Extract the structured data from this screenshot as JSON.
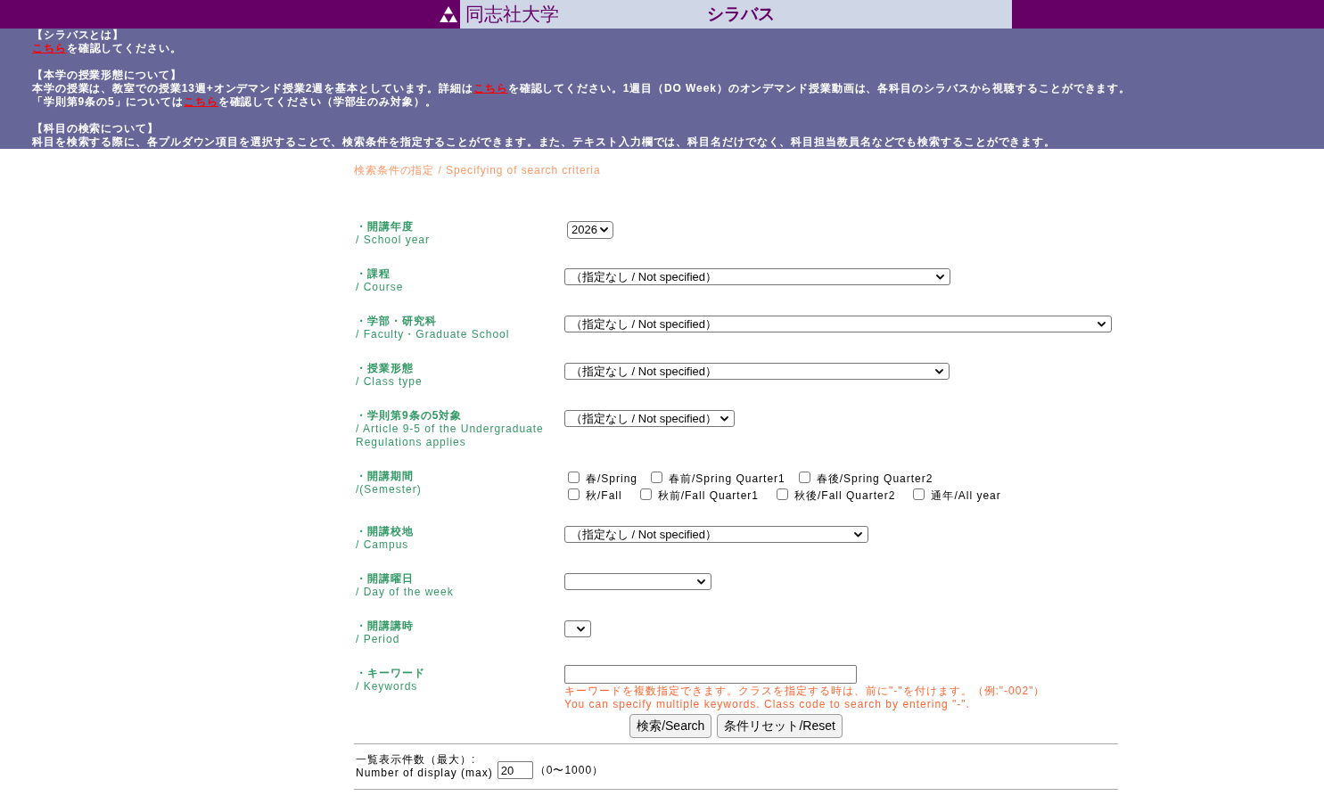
{
  "header": {
    "university": "同志社大学",
    "title": "シラバス"
  },
  "notices": [
    {
      "heading": "【シラバスとは】",
      "lines": [
        [
          {
            "kind": "link",
            "text": "こちら"
          },
          {
            "kind": "text",
            "text": "を確認してください。"
          }
        ]
      ]
    },
    {
      "heading": "【本学の授業形態について】",
      "lines": [
        [
          {
            "kind": "text",
            "text": "本学の授業は、教室での授業13週+オンデマンド授業2週を基本としています。詳細は"
          },
          {
            "kind": "link",
            "text": "こちら"
          },
          {
            "kind": "text",
            "text": "を確認してください。1週目（DO Week）のオンデマンド授業動画は、各科目のシラバスから視聴することができます。"
          }
        ],
        [
          {
            "kind": "text",
            "text": "「学則第9条の5」については"
          },
          {
            "kind": "link",
            "text": "こちら"
          },
          {
            "kind": "text",
            "text": "を確認してください（学部生のみ対象）。"
          }
        ]
      ]
    },
    {
      "heading": "【科目の検索について】",
      "lines": [
        [
          {
            "kind": "text",
            "text": "科目を検索する際に、各プルダウン項目を選択することで、検索条件を指定することができます。また、テキスト入力欄では、科目名だけでなく、科目担当教員名などでも検索することができます。"
          }
        ]
      ]
    }
  ],
  "search_form": {
    "title": "検索条件の指定 / Specifying of search criteria",
    "fields": [
      {
        "kind": "select",
        "label_ja": "・開講年度",
        "label_en": "/ School year",
        "value": "2026"
      },
      {
        "kind": "select",
        "label_ja": "・課程",
        "label_en": "/ Course",
        "value": "（指定なし / Not specified）"
      },
      {
        "kind": "select",
        "label_ja": "・学部・研究科",
        "label_en": "/ Faculty・Graduate School",
        "value": "（指定なし / Not specified）"
      },
      {
        "kind": "select",
        "label_ja": "・授業形態",
        "label_en": "/ Class type",
        "value": "（指定なし / Not specified）"
      },
      {
        "kind": "select",
        "label_ja": "・学則第9条の5対象",
        "label_en": "/ Article 9-5 of the Undergraduate Regulations applies",
        "value": "（指定なし / Not specified）"
      },
      {
        "kind": "checkboxes",
        "label_ja": "・開講期間",
        "label_en": "/(Semester)",
        "option_rows": [
          [
            {
              "label": "春/Spring",
              "checked": false
            },
            {
              "label": "春前/Spring Quarter1",
              "checked": false
            },
            {
              "label": "春後/Spring Quarter2",
              "checked": false
            }
          ],
          [
            {
              "label": "秋/Fall",
              "checked": false
            },
            {
              "label": "秋前/Fall Quarter1",
              "checked": false
            },
            {
              "label": "秋後/Fall Quarter2",
              "checked": false
            },
            {
              "label": "通年/All year",
              "checked": false
            }
          ]
        ]
      },
      {
        "kind": "select",
        "label_ja": "・開講校地",
        "label_en": "/ Campus",
        "value": "（指定なし / Not specified）"
      },
      {
        "kind": "select",
        "label_ja": "・開講曜日",
        "label_en": "/ Day of the week"
      },
      {
        "kind": "select",
        "label_ja": "・開講講時",
        "label_en": "/ Period"
      },
      {
        "kind": "text",
        "label_ja": "・キーワード",
        "label_en": "/ Keywords",
        "notes": [
          "キーワードを複数指定できます。クラスを指定する時は、前に\"-\"を付けます。（例:\"-002\"）",
          "You can specify multiple keywords. Class code to search by entering \"-\"."
        ]
      }
    ],
    "buttons": [
      "検索/Search",
      "条件リセット/Reset"
    ],
    "display_count": {
      "label_ja": "一覧表示件数（最大）:",
      "label_en": "Number of display (max)",
      "value": "20",
      "range": "（0〜1000）"
    }
  }
}
